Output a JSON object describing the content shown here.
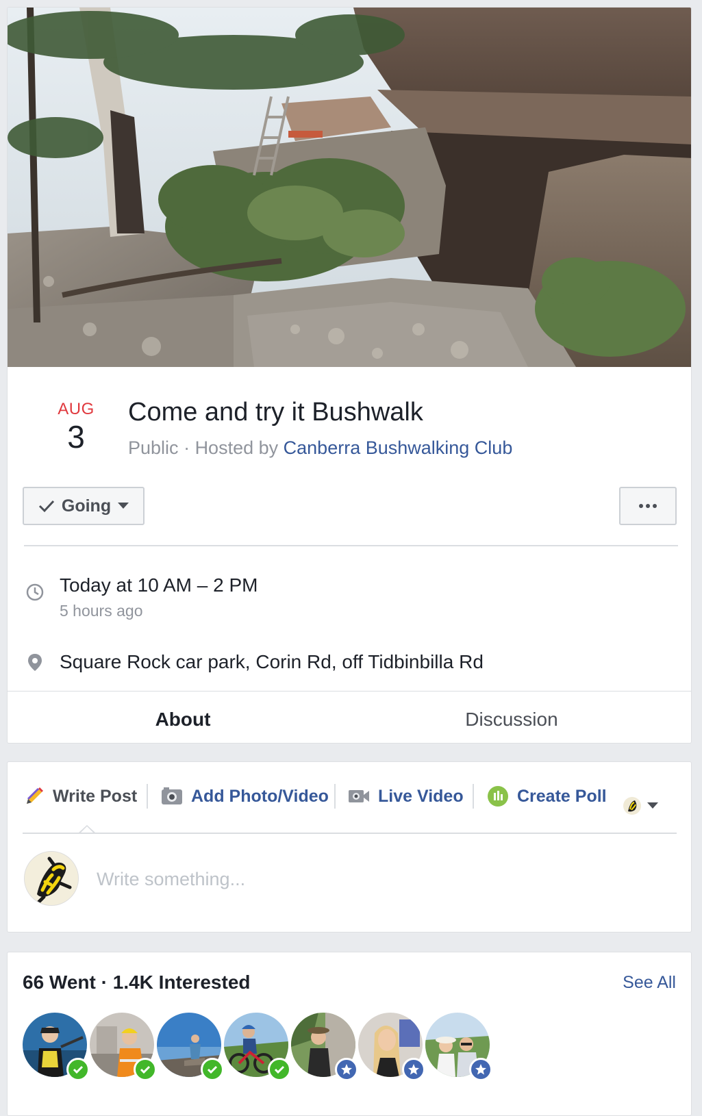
{
  "event": {
    "month": "AUG",
    "day": "3",
    "title": "Come and try it Bushwalk",
    "privacy": "Public",
    "hosted_by_prefix": "Hosted by",
    "host": "Canberra Bushwalking Club",
    "rsvp_label": "Going",
    "time_main": "Today at 10 AM – 2 PM",
    "time_sub": "5 hours ago",
    "location": "Square Rock car park, Corin Rd, off Tidbinbilla Rd",
    "tabs": [
      {
        "label": "About",
        "active": true
      },
      {
        "label": "Discussion",
        "active": false
      }
    ]
  },
  "composer": {
    "tabs": [
      {
        "label": "Write Post",
        "icon": "pencil-icon"
      },
      {
        "label": "Add Photo/Video",
        "icon": "camera-icon"
      },
      {
        "label": "Live Video",
        "icon": "video-camera-icon"
      },
      {
        "label": "Create Poll",
        "icon": "poll-icon"
      }
    ],
    "placeholder": "Write something..."
  },
  "guests": {
    "went_count": "66 Went",
    "interested_count": "1.4K Interested",
    "see_all": "See All",
    "avatars": [
      {
        "status": "going"
      },
      {
        "status": "going"
      },
      {
        "status": "going"
      },
      {
        "status": "going"
      },
      {
        "status": "interested"
      },
      {
        "status": "interested"
      },
      {
        "status": "interested"
      }
    ]
  },
  "colors": {
    "accent": "#4267b2",
    "link": "#365899",
    "month": "#e0393e",
    "going_badge": "#42b72a",
    "interested_badge": "#4267b2"
  }
}
